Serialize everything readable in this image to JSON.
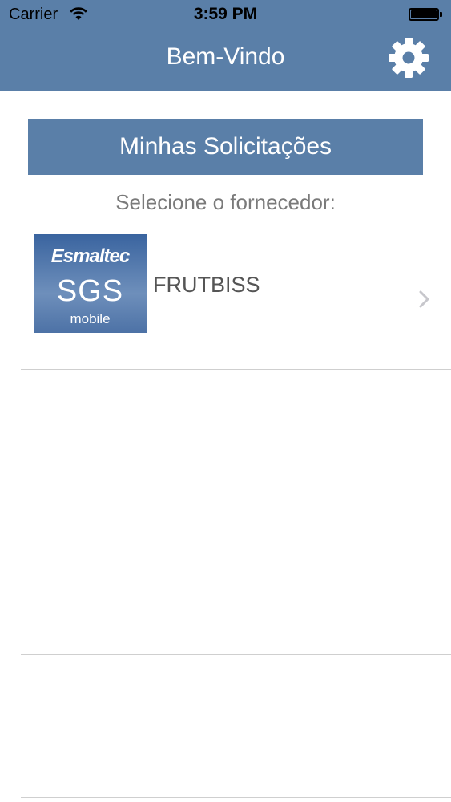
{
  "status_bar": {
    "carrier": "Carrier",
    "time": "3:59 PM"
  },
  "nav": {
    "title": "Bem-Vindo",
    "settings_icon": "gear-icon"
  },
  "main": {
    "requests_button_label": "Minhas Solicitações",
    "select_label": "Selecione o fornecedor:",
    "suppliers": [
      {
        "name": "FRUTBISS",
        "logo": {
          "brand": "Esmaltec",
          "product": "SGS",
          "sub": "mobile"
        }
      }
    ]
  },
  "colors": {
    "header": "#5a7fa8",
    "button": "#5a7fa8",
    "label_text": "#7a7a7a",
    "divider": "#cfcfcf"
  }
}
